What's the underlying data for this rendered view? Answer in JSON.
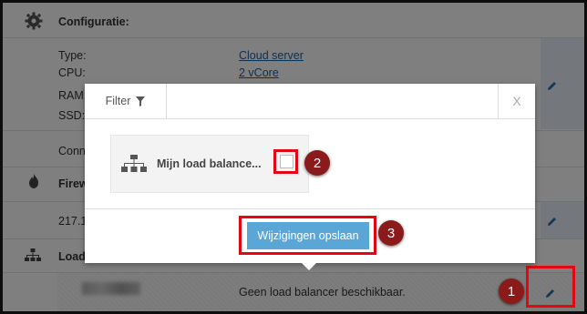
{
  "background": {
    "section_title": "Configuratie:",
    "specs": [
      {
        "label": "Type:",
        "value": "Cloud server"
      },
      {
        "label": "CPU:",
        "value": "2 vCore"
      },
      {
        "label": "RAM:",
        "value": ""
      },
      {
        "label": "SSD:",
        "value": ""
      }
    ],
    "connection_label": "Conn",
    "firewall_label": "Firew",
    "ip_partial": "217.1",
    "loadbalancer_label": "Load",
    "loadbalancer_status": "Geen load balancer beschikbaar."
  },
  "modal": {
    "filter_label": "Filter",
    "close_label": "X",
    "lb_name": "Mijn load balance...",
    "save_label": "Wijzigingen opslaan"
  },
  "annotations": [
    "1",
    "2",
    "3"
  ],
  "colors": {
    "highlight": "#e30613",
    "badge": "#8b1a1a",
    "button": "#5aa6d6",
    "link": "#1f5f9e"
  }
}
